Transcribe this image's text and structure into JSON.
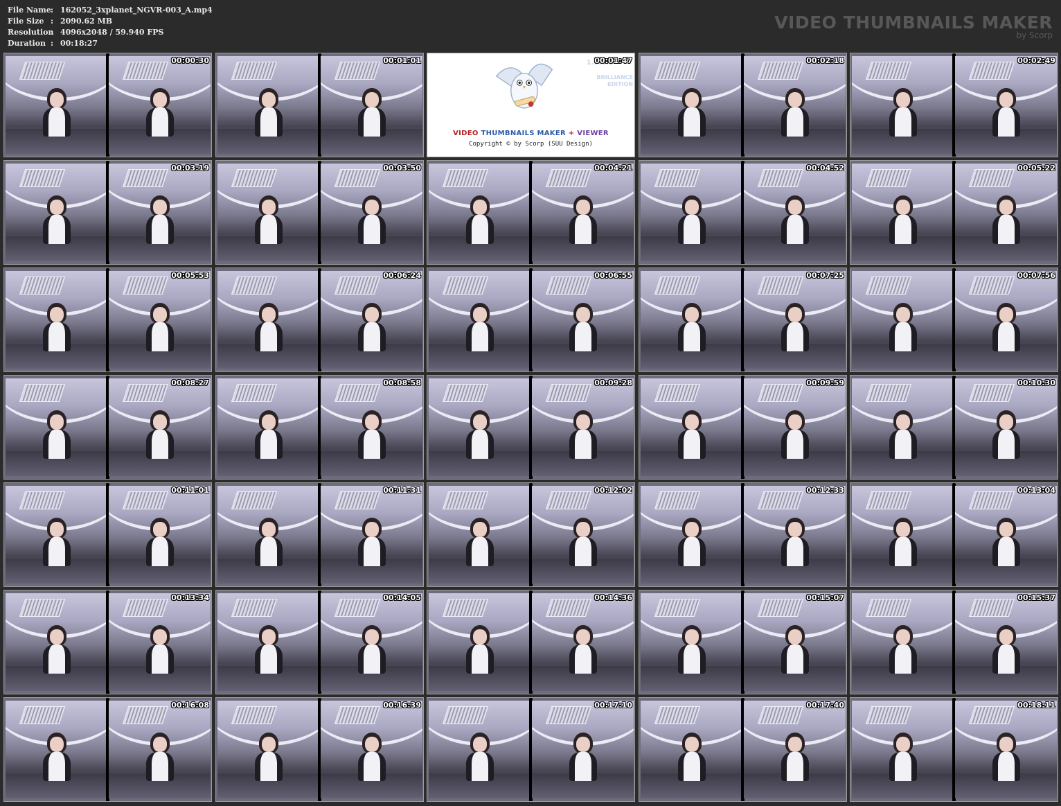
{
  "file_info": {
    "rows": [
      {
        "key": "File Name",
        "value": "162052_3xplanet_NGVR-003_A.mp4"
      },
      {
        "key": "File Size",
        "value": "2090.62 MB"
      },
      {
        "key": "Resolution",
        "value": "4096x2048 / 59.940 FPS"
      },
      {
        "key": "Duration",
        "value": "00:18:27"
      }
    ],
    "separator": ":"
  },
  "brand": {
    "title": "VIDEO THUMBNAILS MAKER",
    "subtitle": "by Scorp"
  },
  "logo_tile": {
    "version": "1.0.0.3",
    "edition_line1": "BRILLIANCE",
    "edition_line2": "EDITION",
    "title_video": "VIDEO",
    "title_thumbs": "THUMBNAILS MAKER",
    "title_plus": "+",
    "title_viewer": "VIEWER",
    "copyright": "Copyright © by Scorp (SUU Design)"
  },
  "thumbnails": [
    "00:00:30",
    "00:01:01",
    "00:01:47",
    "00:02:18",
    "00:02:49",
    "00:03:19",
    "00:03:50",
    "00:04:21",
    "00:04:52",
    "00:05:22",
    "00:05:53",
    "00:06:24",
    "00:06:55",
    "00:07:25",
    "00:07:56",
    "00:08:27",
    "00:08:58",
    "00:09:28",
    "00:09:59",
    "00:10:30",
    "00:11:01",
    "00:11:31",
    "00:12:02",
    "00:12:33",
    "00:13:04",
    "00:13:34",
    "00:14:05",
    "00:14:36",
    "00:15:07",
    "00:15:37",
    "00:16:08",
    "00:16:39",
    "00:17:10",
    "00:17:40",
    "00:18:11"
  ],
  "logo_tile_index": 2,
  "colors": {
    "background": "#2b2b2b",
    "brand_text": "#585858",
    "meta_text": "#e8e8e8",
    "timestamp_text": "#ffffff"
  }
}
